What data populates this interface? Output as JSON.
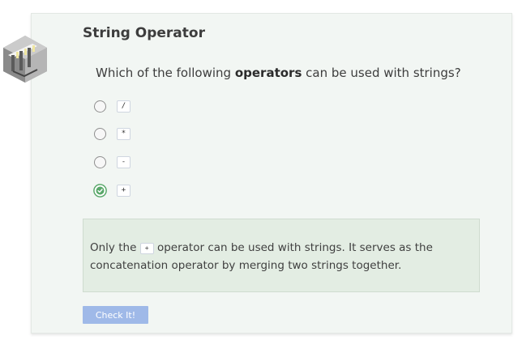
{
  "exercise": {
    "title": "String Operator",
    "question": {
      "before": "Which of the following ",
      "emphasis": "operators",
      "after": " can be used with strings?"
    },
    "options": [
      {
        "code": "/",
        "selected": false
      },
      {
        "code": "*",
        "selected": false
      },
      {
        "code": "-",
        "selected": false
      },
      {
        "code": "+",
        "selected": true
      }
    ],
    "feedback": {
      "before": "Only the ",
      "code": "+",
      "after": " operator can be used with strings. It serves as the concatenation operator by merging two strings together."
    },
    "check_button_label": "Check It!"
  },
  "icons": {
    "logo": "gate-cube-icon",
    "selected_radio": "checkmark-circle-icon"
  },
  "colors": {
    "card_background": "#f2f6f3",
    "feedback_background": "#e3ede3",
    "button_background": "#9fb9e8",
    "selected_accent": "#5aa86a"
  }
}
